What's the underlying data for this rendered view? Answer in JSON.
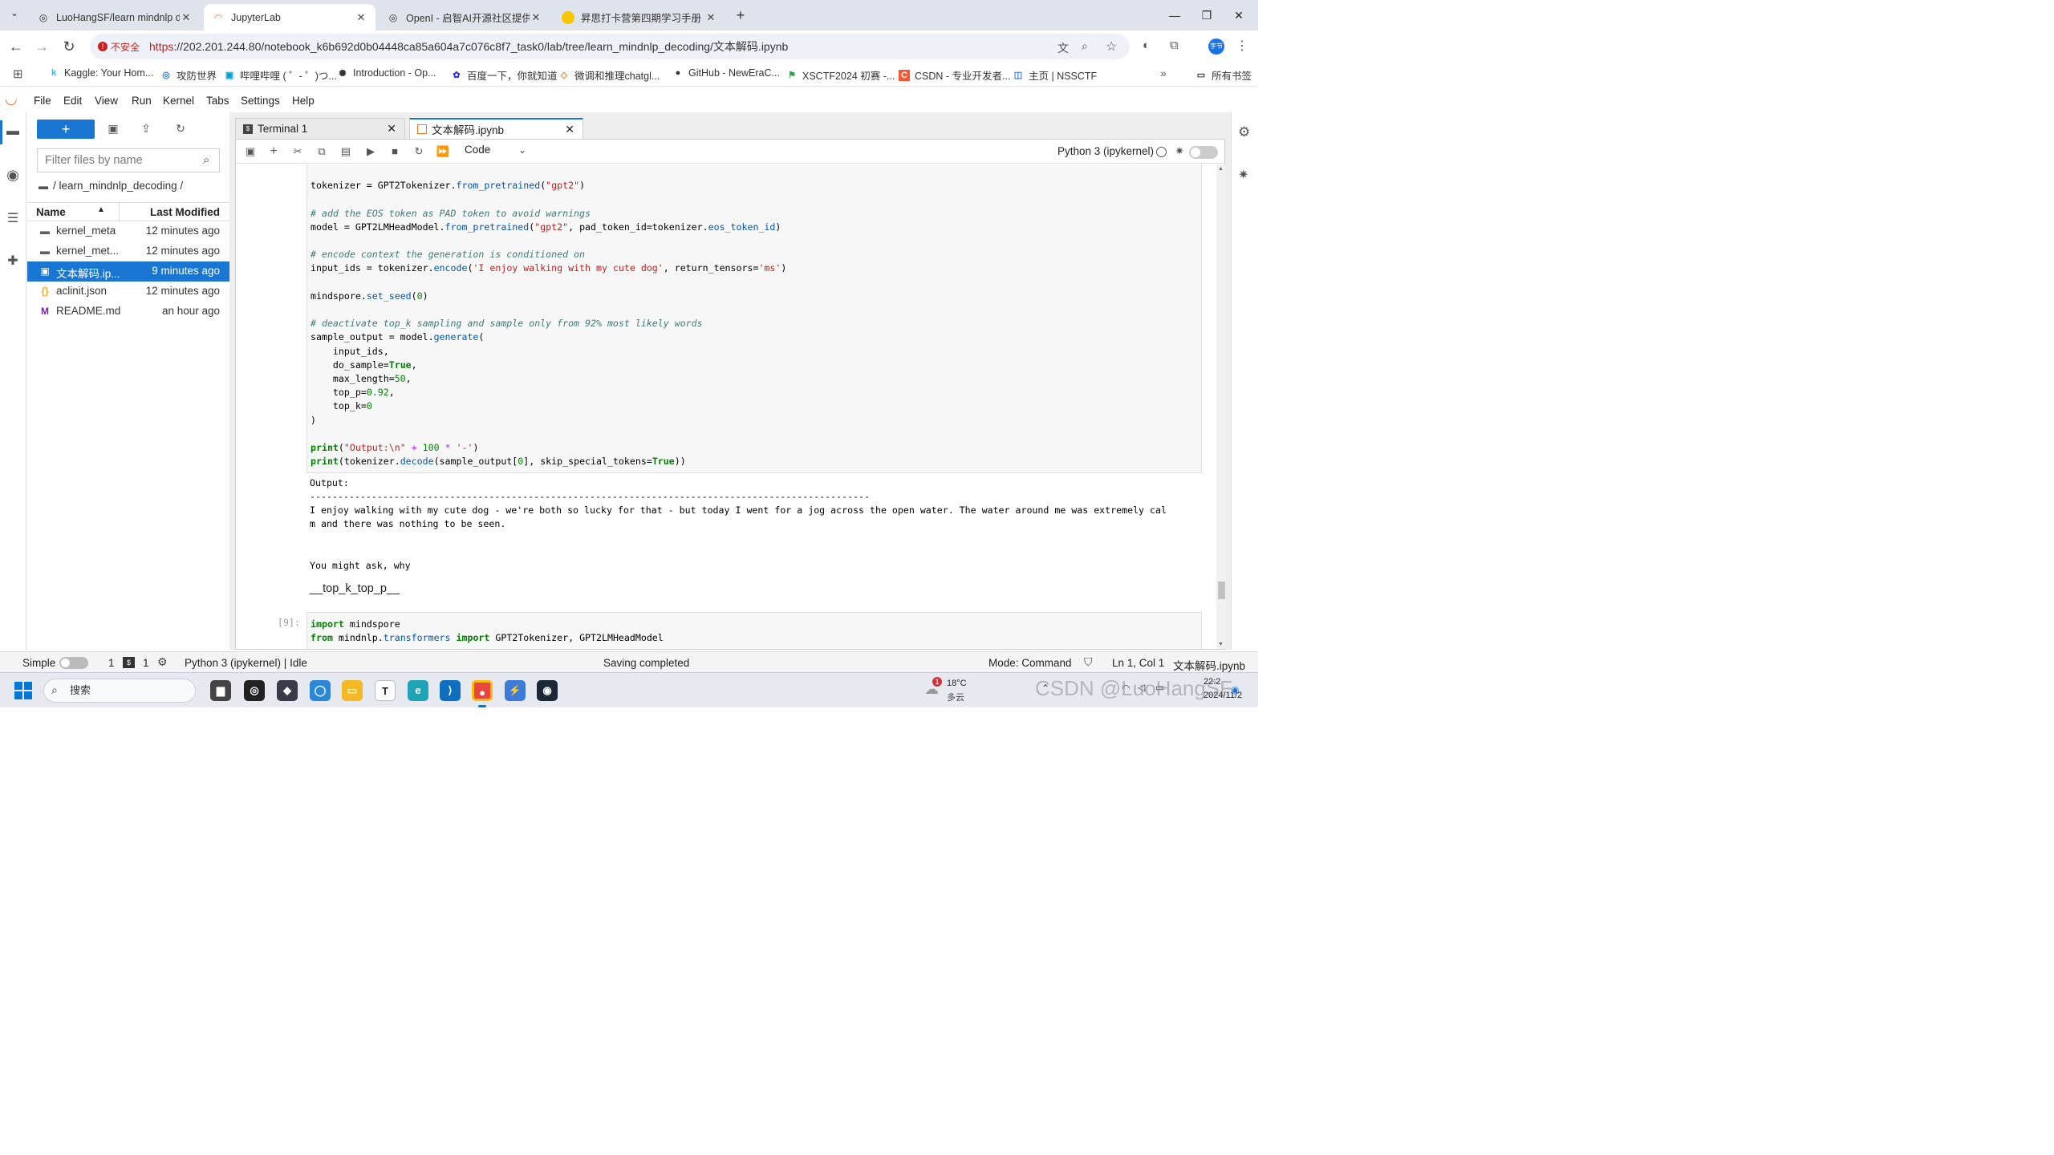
{
  "browser": {
    "tabs": [
      {
        "title": "LuoHangSF/learn mindnlp d",
        "icon": "github-icon"
      },
      {
        "title": "JupyterLab",
        "icon": "jupyter-icon"
      },
      {
        "title": "OpenI - 启智AI开源社区提供普",
        "icon": "openi-icon"
      },
      {
        "title": "昇思打卡营第四期学习手册（启",
        "icon": "mindspore-icon"
      }
    ],
    "new_tab": "+",
    "address": {
      "warning": "不安全",
      "scheme": "https",
      "rest": "://202.201.244.80/notebook_k6b692d0b04448ca85a604a7c076c8f7_task0/lab/tree/learn_mindnlp_decoding/文本解码.ipynb"
    },
    "profile": "字节",
    "bookmarks": [
      "Kaggle: Your Hom...",
      "攻防世界",
      "哔哩哔哩 ( ゜- ゜)つ...",
      "Introduction - Op...",
      "百度一下，你就知道",
      "微调和推理chatgl...",
      "GitHub - NewEraC...",
      "XSCTF2024 初赛 -...",
      "CSDN - 专业开发者...",
      "主页 | NSSCTF"
    ],
    "all_bookmarks": "所有书签"
  },
  "jupyter": {
    "menu": [
      "File",
      "Edit",
      "View",
      "Run",
      "Kernel",
      "Tabs",
      "Settings",
      "Help"
    ],
    "filebrowser": {
      "new_label": "+",
      "filter_placeholder": "Filter files by name",
      "breadcrumb": "/ learn_mindnlp_decoding /",
      "col_name": "Name",
      "col_modified": "Last Modified",
      "files": [
        {
          "name": "kernel_meta",
          "modified": "12 minutes ago",
          "icon": "folder-icon"
        },
        {
          "name": "kernel_met...",
          "modified": "12 minutes ago",
          "icon": "folder-icon"
        },
        {
          "name": "文本解码.ip...",
          "modified": "9 minutes ago",
          "icon": "notebook-icon"
        },
        {
          "name": "aclinit.json",
          "modified": "12 minutes ago",
          "icon": "json-icon"
        },
        {
          "name": "README.md",
          "modified": "an hour ago",
          "icon": "markdown-icon"
        }
      ]
    },
    "tabs": [
      {
        "label": "Terminal 1"
      },
      {
        "label": "文本解码.ipynb"
      }
    ],
    "cell_type": "Code",
    "kernel": "Python 3 (ipykernel)",
    "output": {
      "header": "Output:",
      "rule": "----------------------------------------------------------------------------------------------------",
      "line1": "I enjoy walking with my cute dog - we're both so lucky for that - but today I went for a jog across the open water. The water around me was extremely cal",
      "line2": "m and there was nothing to be seen.",
      "line3": "You might ask, why"
    },
    "markdown_text": "__top_k_top_p__",
    "next_prompt": "[9]:",
    "status": {
      "mode_label": "Simple",
      "count1": "1",
      "count2": "1",
      "kernel_status": "Python 3 (ipykernel) | Idle",
      "message": "Saving completed",
      "mode": "Mode: Command",
      "position": "Ln 1, Col 1",
      "filename": "文本解码.ipynb"
    }
  },
  "taskbar": {
    "search": "搜索",
    "weather_temp": "18°C",
    "weather_desc": "多云",
    "badge": "1",
    "time": "22:2",
    "date": "2024/11/2"
  },
  "watermark": "CSDN @LuoHangSF"
}
